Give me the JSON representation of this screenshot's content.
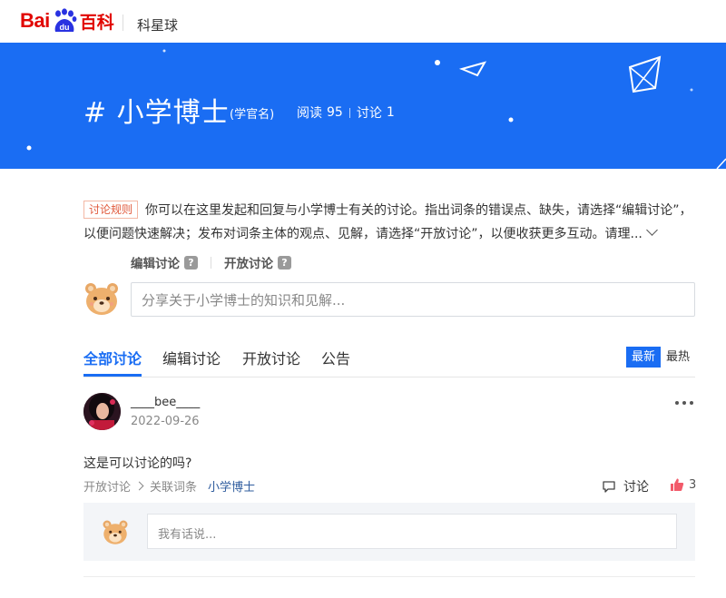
{
  "header": {
    "logo_left": "Bai",
    "logo_mid": "du",
    "logo_right": "百科",
    "section": "科星球"
  },
  "banner": {
    "title": "# 小学博士",
    "alias": "(学官名)",
    "reads_label": "阅读",
    "reads_count": "95",
    "discuss_label": "讨论",
    "discuss_count": "1"
  },
  "rules": {
    "tag": "讨论规则",
    "text": "你可以在这里发起和回复与小学博士有关的讨论。指出词条的错误点、缺失，请选择“编辑讨论”，以便问题快速解决；发布对词条主体的观点、见解，请选择“开放讨论”，以便收获更多互动。请理..."
  },
  "modes": {
    "edit": "编辑讨论",
    "open": "开放讨论",
    "help": "?"
  },
  "share": {
    "placeholder": "分享关于小学博士的知识和见解..."
  },
  "tabs": {
    "items": [
      "全部讨论",
      "编辑讨论",
      "开放讨论",
      "公告"
    ],
    "active_index": 0,
    "sort_latest": "最新",
    "sort_hot": "最热"
  },
  "post": {
    "username": "____bee____",
    "date": "2022-09-26",
    "body": "这是可以讨论的吗?",
    "type": "开放讨论",
    "related_label": "关联词条",
    "related_entry": "小学博士",
    "discuss_label": "讨论",
    "likes": "3",
    "reply_placeholder": "我有话说..."
  },
  "colors": {
    "brand_blue": "#1a6df3",
    "baidu_red": "#e10601",
    "like_red": "#f25a6a"
  }
}
